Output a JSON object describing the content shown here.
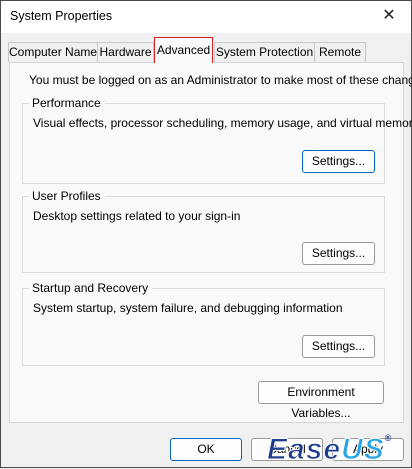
{
  "window": {
    "title": "System Properties",
    "close_glyph": "✕"
  },
  "tabs": [
    {
      "label": "Computer Name"
    },
    {
      "label": "Hardware"
    },
    {
      "label": "Advanced"
    },
    {
      "label": "System Protection"
    },
    {
      "label": "Remote"
    }
  ],
  "notice": "You must be logged on as an Administrator to make most of these changes.",
  "performance": {
    "title": "Performance",
    "description": "Visual effects, processor scheduling, memory usage, and virtual memory",
    "button": "Settings..."
  },
  "user_profiles": {
    "title": "User Profiles",
    "description": "Desktop settings related to your sign-in",
    "button": "Settings..."
  },
  "startup_recovery": {
    "title": "Startup and Recovery",
    "description": "System startup, system failure, and debugging information",
    "button": "Settings..."
  },
  "env_button": "Environment Variables...",
  "footer": {
    "ok": "OK",
    "cancel": "Cancel",
    "apply": "Apply"
  },
  "watermark": {
    "part1": "Ease",
    "part2": "US",
    "reg": "®"
  },
  "colors": {
    "highlight": "#d81e1e",
    "logo_dark": "#1f3d8f",
    "logo_light": "#2aa5e6"
  }
}
